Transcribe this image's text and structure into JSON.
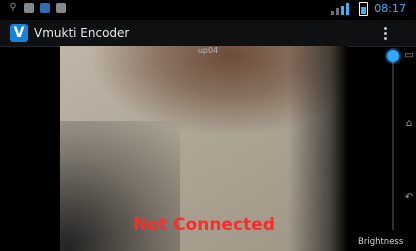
{
  "status_bar": {
    "time": "08:17"
  },
  "app": {
    "icon_letter": "V",
    "title": "Vmukti Encoder"
  },
  "stream": {
    "label": "up04",
    "connection_status": "Not Connected"
  },
  "brightness": {
    "label": "Brightness",
    "level": 1.0
  },
  "colors": {
    "accent": "#2fa9ff",
    "status_error": "#ff2a2a",
    "app_icon_bg": "#1683da"
  }
}
